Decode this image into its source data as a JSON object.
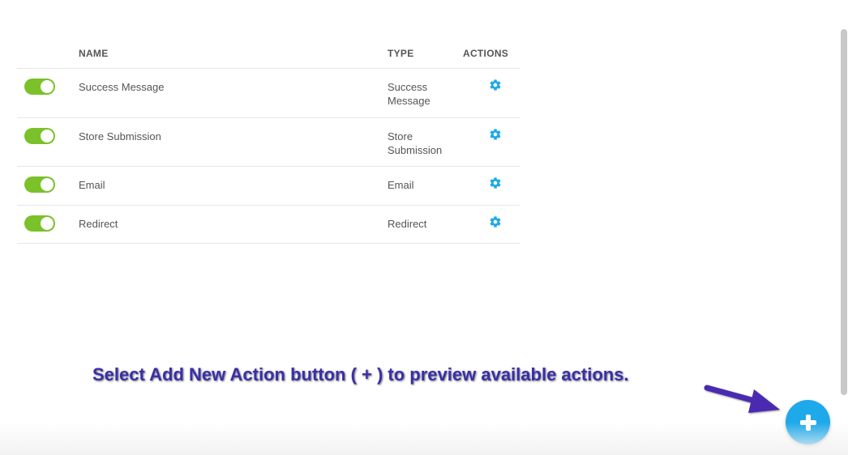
{
  "table": {
    "headers": {
      "toggle": "",
      "name": "NAME",
      "type": "TYPE",
      "actions": "ACTIONS"
    },
    "rows": [
      {
        "enabled": true,
        "name": "Success Message",
        "type_line1": "Success",
        "type_line2": "Message"
      },
      {
        "enabled": true,
        "name": "Store Submission",
        "type_line1": "Store",
        "type_line2": "Submission"
      },
      {
        "enabled": true,
        "name": "Email",
        "type_line1": "Email",
        "type_line2": ""
      },
      {
        "enabled": true,
        "name": "Redirect",
        "type_line1": "Redirect",
        "type_line2": ""
      }
    ]
  },
  "annotation": {
    "text": "Select Add New Action button ( + ) to preview available actions."
  },
  "icons": {
    "row_action": "gear-icon",
    "add": "plus-icon",
    "pointer": "arrow-icon"
  },
  "colors": {
    "toggle_on": "#7ac12a",
    "accent": "#1ea9ea",
    "annotation": "#3a2fa8"
  }
}
